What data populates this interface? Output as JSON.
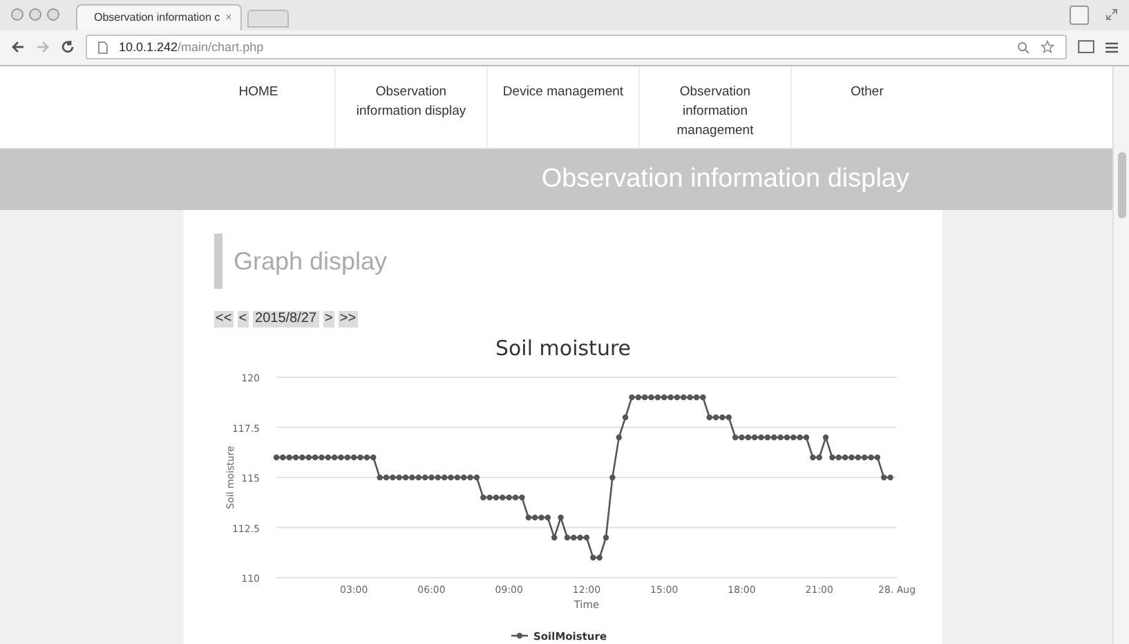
{
  "browser": {
    "tab": {
      "title": "Observation information c",
      "close": "×"
    },
    "address": {
      "host": "10.0.1.242",
      "path": "/main/chart.php"
    }
  },
  "nav": {
    "items": [
      {
        "lines": [
          "HOME"
        ]
      },
      {
        "lines": [
          "Observation",
          "information display"
        ]
      },
      {
        "lines": [
          "Device management"
        ]
      },
      {
        "lines": [
          "Observation",
          "information",
          "management"
        ]
      },
      {
        "lines": [
          "Other"
        ]
      }
    ]
  },
  "banner": {
    "title": "Observation information display"
  },
  "section": {
    "heading": "Graph display",
    "date_nav": [
      {
        "kind": "first",
        "label": "<<"
      },
      {
        "kind": "prev",
        "label": "<"
      },
      {
        "kind": "date",
        "label": "2015/8/27"
      },
      {
        "kind": "next",
        "label": ">"
      },
      {
        "kind": "last",
        "label": ">>"
      }
    ]
  },
  "chart": {
    "chart_data": {
      "type": "line",
      "grid": true,
      "title": "Soil moisture",
      "xlabel": "Time",
      "ylabel": "Soil moisture",
      "xlim": [
        0,
        24
      ],
      "ylim": [
        110,
        120
      ],
      "xticks": [
        {
          "value": 3,
          "label": "03:00"
        },
        {
          "value": 6,
          "label": "06:00"
        },
        {
          "value": 9,
          "label": "09:00"
        },
        {
          "value": 12,
          "label": "12:00"
        },
        {
          "value": 15,
          "label": "15:00"
        },
        {
          "value": 18,
          "label": "18:00"
        },
        {
          "value": 21,
          "label": "21:00"
        },
        {
          "value": 24,
          "label": "28. Aug"
        }
      ],
      "yticks": [
        {
          "value": 110,
          "label": "110"
        },
        {
          "value": 112.5,
          "label": "112.5"
        },
        {
          "value": 115,
          "label": "115"
        },
        {
          "value": 117.5,
          "label": "117.5"
        },
        {
          "value": 120,
          "label": "120"
        }
      ],
      "x": [
        0,
        0.25,
        0.5,
        0.75,
        1,
        1.25,
        1.5,
        1.75,
        2,
        2.25,
        2.5,
        2.75,
        3,
        3.25,
        3.5,
        3.75,
        4,
        4.25,
        4.5,
        4.75,
        5,
        5.25,
        5.5,
        5.75,
        6,
        6.25,
        6.5,
        6.75,
        7,
        7.25,
        7.5,
        7.75,
        8,
        8.25,
        8.5,
        8.75,
        9,
        9.25,
        9.5,
        9.75,
        10,
        10.25,
        10.5,
        10.75,
        11,
        11.25,
        11.5,
        11.75,
        12,
        12.25,
        12.5,
        12.75,
        13,
        13.25,
        13.5,
        13.75,
        14,
        14.25,
        14.5,
        14.75,
        15,
        15.25,
        15.5,
        15.75,
        16,
        16.25,
        16.5,
        16.75,
        17,
        17.25,
        17.5,
        17.75,
        18,
        18.25,
        18.5,
        18.75,
        19,
        19.25,
        19.5,
        19.75,
        20,
        20.25,
        20.5,
        20.75,
        21,
        21.25,
        21.5,
        21.75,
        22,
        22.25,
        22.5,
        22.75,
        23,
        23.25,
        23.5,
        23.75
      ],
      "series": [
        {
          "name": "SoilMoisture",
          "color": "#555555",
          "marker": true,
          "values": [
            116,
            116,
            116,
            116,
            116,
            116,
            116,
            116,
            116,
            116,
            116,
            116,
            116,
            116,
            116,
            116,
            115,
            115,
            115,
            115,
            115,
            115,
            115,
            115,
            115,
            115,
            115,
            115,
            115,
            115,
            115,
            115,
            114,
            114,
            114,
            114,
            114,
            114,
            114,
            113,
            113,
            113,
            113,
            112,
            113,
            112,
            112,
            112,
            112,
            111,
            111,
            112,
            115,
            117,
            118,
            119,
            119,
            119,
            119,
            119,
            119,
            119,
            119,
            119,
            119,
            119,
            119,
            118,
            118,
            118,
            118,
            117,
            117,
            117,
            117,
            117,
            117,
            117,
            117,
            117,
            117,
            117,
            117,
            116,
            116,
            117,
            116,
            116,
            116,
            116,
            116,
            116,
            116,
            116,
            115,
            115
          ]
        }
      ]
    }
  }
}
